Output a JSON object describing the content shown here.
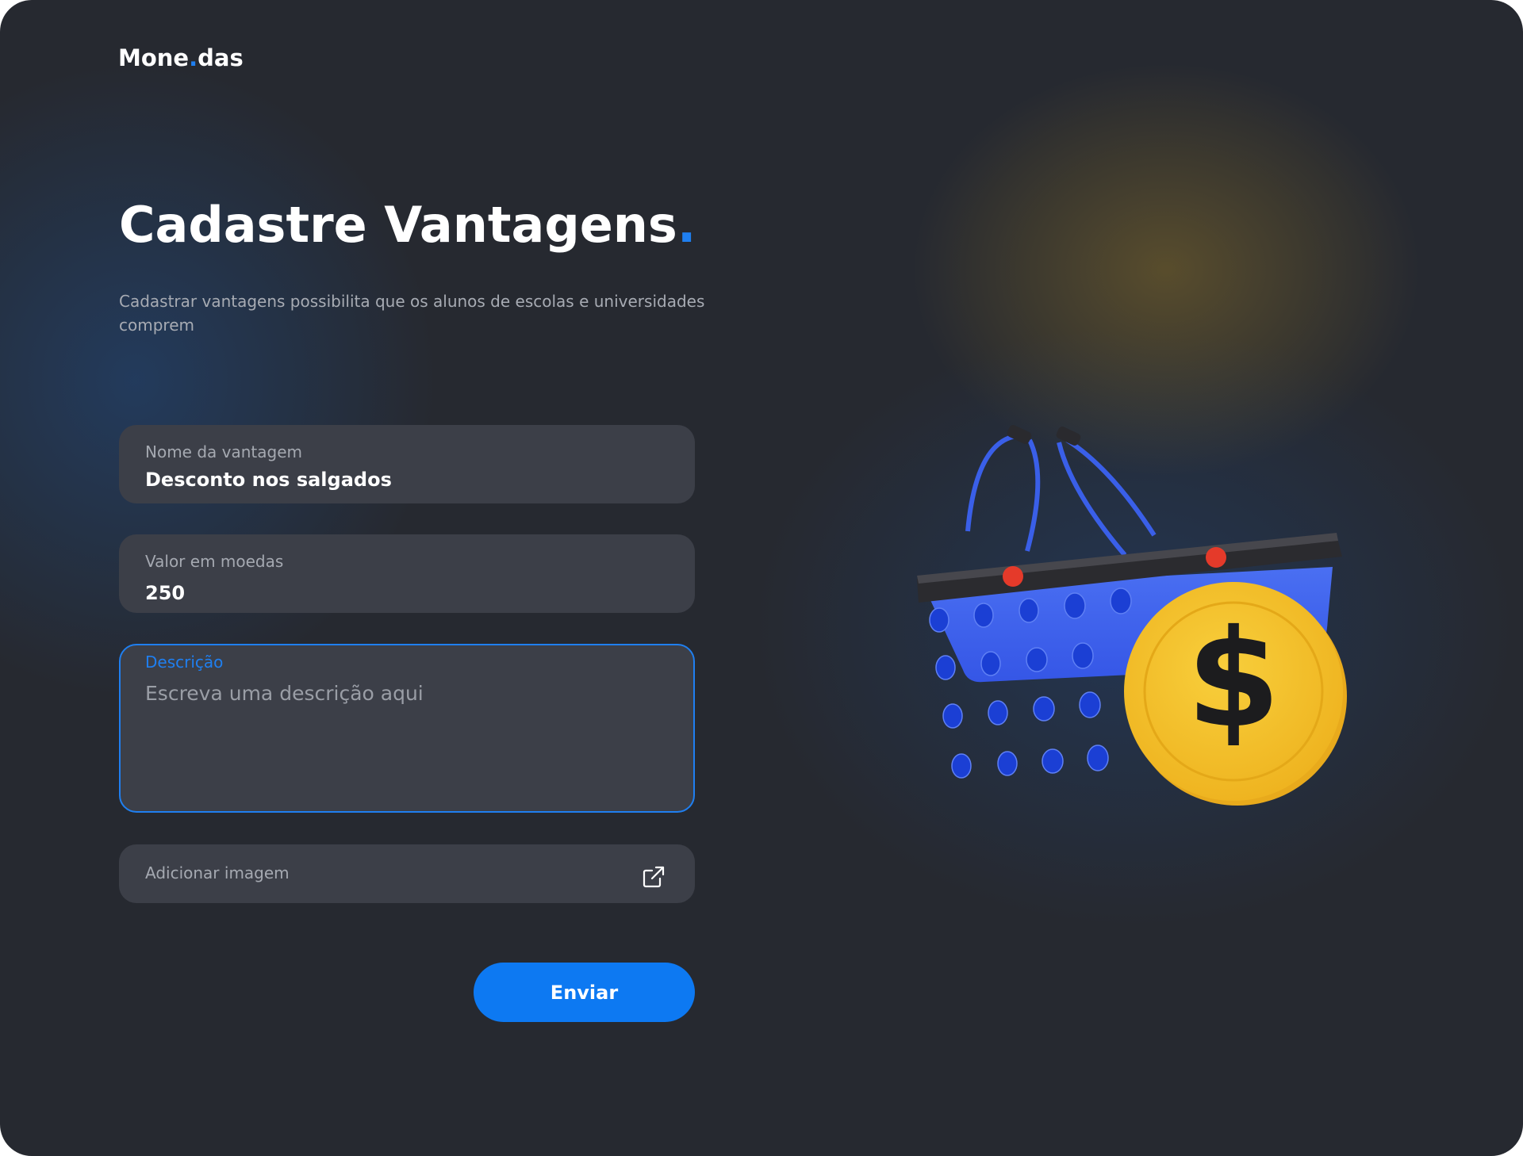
{
  "brand": {
    "name_part1": "Mone",
    "dot": ".",
    "name_part2": "das"
  },
  "header": {
    "title": "Cadastre Vantagens",
    "title_dot": ".",
    "subtitle": "Cadastrar vantagens possibilita que os alunos de escolas e universidades comprem"
  },
  "form": {
    "name": {
      "label": "Nome da vantagem",
      "value": "Desconto nos salgados"
    },
    "coins": {
      "label": "Valor em moedas",
      "value": "250"
    },
    "description": {
      "label": "Descrição",
      "placeholder": "Escreva uma descrição aqui",
      "value": ""
    },
    "image": {
      "label": "Adicionar imagem",
      "icon": "external-link-icon"
    },
    "submit_label": "Enviar"
  },
  "illustration": {
    "basket_icon": "shopping-basket-icon",
    "coin_icon": "dollar-coin-icon",
    "coin_symbol": "$"
  },
  "colors": {
    "accent": "#1f7ff0",
    "button": "#0d79f2",
    "background": "#262930",
    "field": "#3c3f48",
    "basket": "#3b63ee",
    "coin": "#f2bf2c"
  }
}
